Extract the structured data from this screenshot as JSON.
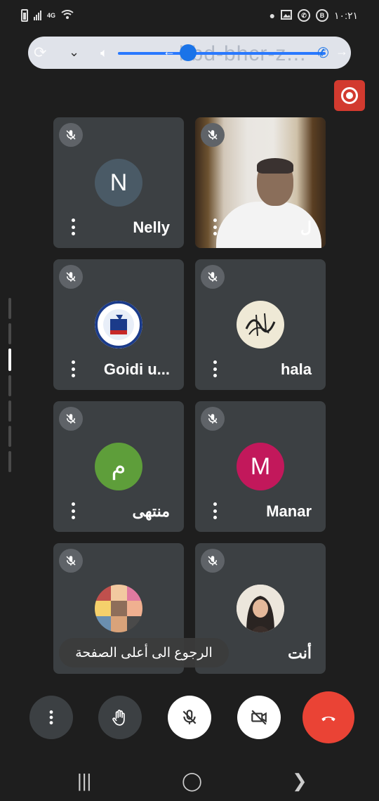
{
  "status_bar": {
    "time": "١٠:٢١",
    "network": "4G",
    "icons_left": [
      "battery-icon",
      "signal-bars-icon",
      "4g-icon",
      "wifi-icon"
    ],
    "icons_right": [
      "dot-icon",
      "gallery-icon",
      "whatsapp-icon",
      "b-circle-icon"
    ]
  },
  "call_bar": {
    "meeting_code": "bbd-bhcr-z...",
    "volume_level": 0.35,
    "accent": "#1a73e8"
  },
  "record_button": {
    "icon": "record-icon",
    "color": "#d23a2f"
  },
  "participants": [
    {
      "name": "Nelly",
      "type": "initial",
      "initial": "N",
      "avatar_color": "#4a5a66",
      "muted": true
    },
    {
      "name": "ل",
      "type": "video",
      "muted": true
    },
    {
      "name": "Goidi u...",
      "type": "image",
      "image": "goidi-logo",
      "muted": true
    },
    {
      "name": "hala",
      "type": "image",
      "image": "calligraphy-avatar",
      "muted": true
    },
    {
      "name": "منتهى",
      "type": "initial",
      "initial": "م",
      "avatar_color": "#5e9e3a",
      "muted": true
    },
    {
      "name": "Manar",
      "type": "initial",
      "initial": "M",
      "avatar_color": "#c2185b",
      "muted": true
    },
    {
      "name": "",
      "type": "image",
      "image": "kids-collage-avatar",
      "muted": true
    },
    {
      "name": "أنت",
      "type": "image",
      "image": "woman-hijab-avatar",
      "muted": true
    }
  ],
  "toast": {
    "text": "الرجوع الى أعلى الصفحة"
  },
  "controls": [
    {
      "name": "more-options-button",
      "icon": "more-vert-icon"
    },
    {
      "name": "raise-hand-button",
      "icon": "hand-icon"
    },
    {
      "name": "mic-toggle-button",
      "icon": "mic-off-icon"
    },
    {
      "name": "camera-toggle-button",
      "icon": "camera-off-icon"
    },
    {
      "name": "end-call-button",
      "icon": "phone-hangup-icon",
      "color": "#ea4335"
    }
  ],
  "nav_bar": {
    "recent": "|||",
    "home": "◯",
    "back": "❯"
  }
}
